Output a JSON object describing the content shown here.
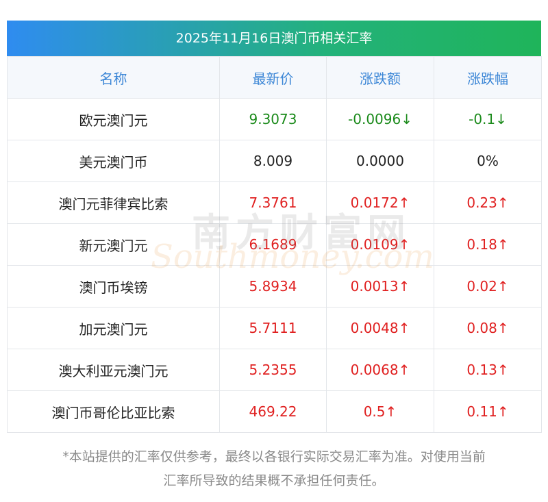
{
  "title": "2025年11月16日澳门币相关汇率",
  "headers": [
    "名称",
    "最新价",
    "涨跌额",
    "涨跌幅"
  ],
  "rows": [
    {
      "name": "欧元澳门元",
      "price": "9.3073",
      "change": "-0.0096↓",
      "pct": "-0.1↓",
      "trend": "down"
    },
    {
      "name": "美元澳门币",
      "price": "8.009",
      "change": "0.0000",
      "pct": "0%",
      "trend": "flat"
    },
    {
      "name": "澳门元菲律宾比索",
      "price": "7.3761",
      "change": "0.0172↑",
      "pct": "0.23↑",
      "trend": "up"
    },
    {
      "name": "新元澳门元",
      "price": "6.1689",
      "change": "0.0109↑",
      "pct": "0.18↑",
      "trend": "up"
    },
    {
      "name": "澳门币埃镑",
      "price": "5.8934",
      "change": "0.0013↑",
      "pct": "0.02↑",
      "trend": "up"
    },
    {
      "name": "加元澳门元",
      "price": "5.7111",
      "change": "0.0048↑",
      "pct": "0.08↑",
      "trend": "up"
    },
    {
      "name": "澳大利亚元澳门元",
      "price": "5.2355",
      "change": "0.0068↑",
      "pct": "0.13↑",
      "trend": "up"
    },
    {
      "name": "澳门币哥伦比亚比索",
      "price": "469.22",
      "change": "0.5↑",
      "pct": "0.11↑",
      "trend": "up"
    }
  ],
  "disclaimer_line1": "*本站提供的汇率仅供参考，最终以各银行实际交易汇率为准。对使用当前",
  "disclaimer_line2": "汇率所导致的结果概不承担任何责任。",
  "watermark": {
    "cn": "南方财富网",
    "en": "Southmoney.com"
  },
  "colors": {
    "up": "#e02020",
    "down": "#1a8a1a",
    "header_text": "#3b86d6",
    "title_start": "#2f8cf0",
    "title_end": "#1fb45a"
  }
}
